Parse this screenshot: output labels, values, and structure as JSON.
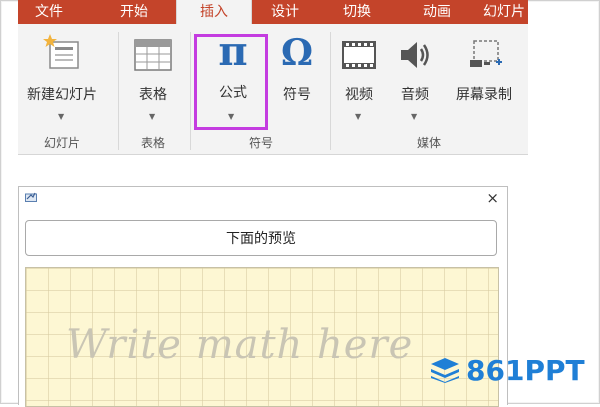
{
  "tabs": [
    "文件",
    "开始",
    "插入",
    "设计",
    "切换",
    "动画",
    "幻灯片"
  ],
  "active_tab": "插入",
  "ribbon": {
    "new_slide": "新建幻灯片",
    "table": "表格",
    "equation": "公式",
    "symbol": "符号",
    "video": "视频",
    "audio": "音频",
    "screen_record": "屏幕录制",
    "groups": {
      "slides": "幻灯片",
      "tables": "表格",
      "symbols": "符号",
      "media": "媒体"
    },
    "pi_glyph": "π",
    "omega_glyph": "Ω"
  },
  "panel": {
    "close": "×",
    "preview_label": "下面的预览",
    "hint": "Write math here"
  },
  "watermark": "861PPT",
  "colors": {
    "tab_bar": "#c4442a",
    "icon_blue": "#2b6ab3",
    "highlight": "#c43ce0",
    "write_area": "#fdf7d3"
  }
}
